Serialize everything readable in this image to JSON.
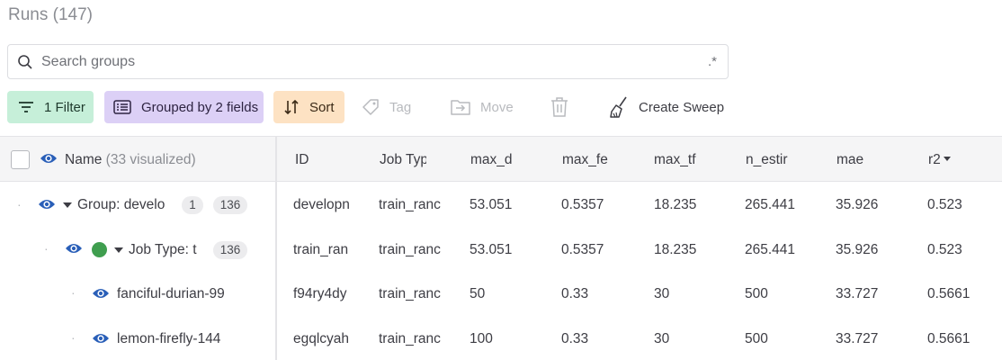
{
  "header": {
    "title": "Runs (147)"
  },
  "search": {
    "placeholder": "Search groups",
    "regex_label": ".*"
  },
  "toolbar": {
    "filter_label": "1 Filter",
    "group_label": "Grouped by 2 fields",
    "sort_label": "Sort",
    "tag_label": "Tag",
    "move_label": "Move",
    "sweep_label": "Create Sweep"
  },
  "table": {
    "name_header": "Name",
    "visualized_label": "(33 visualized)",
    "columns": [
      "ID",
      "Job Typ",
      "max_d",
      "max_fe",
      "max_tf",
      "n_estir",
      "mae",
      "r2"
    ],
    "rows": [
      {
        "name": "Group: develo",
        "badge1": "1",
        "badge2": "136",
        "cells": [
          "developn",
          "train_ranc",
          "53.051",
          "0.5357",
          "18.235",
          "265.441",
          "35.926",
          "0.523"
        ]
      },
      {
        "name": "Job Type: t",
        "badge1": "136",
        "cells": [
          "train_ran",
          "train_ranc",
          "53.051",
          "0.5357",
          "18.235",
          "265.441",
          "35.926",
          "0.523"
        ]
      },
      {
        "name": "fanciful-durian-99",
        "cells": [
          "f94ry4dy",
          "train_ranc",
          "50",
          "0.33",
          "30",
          "500",
          "33.727",
          "0.5661"
        ]
      },
      {
        "name": "lemon-firefly-144",
        "cells": [
          "egqlcyah",
          "train_ranc",
          "100",
          "0.33",
          "30",
          "500",
          "33.727",
          "0.5661"
        ]
      }
    ]
  },
  "colors": {
    "accent_blue": "#2a5fb8",
    "run_green": "#3f9e4f"
  }
}
